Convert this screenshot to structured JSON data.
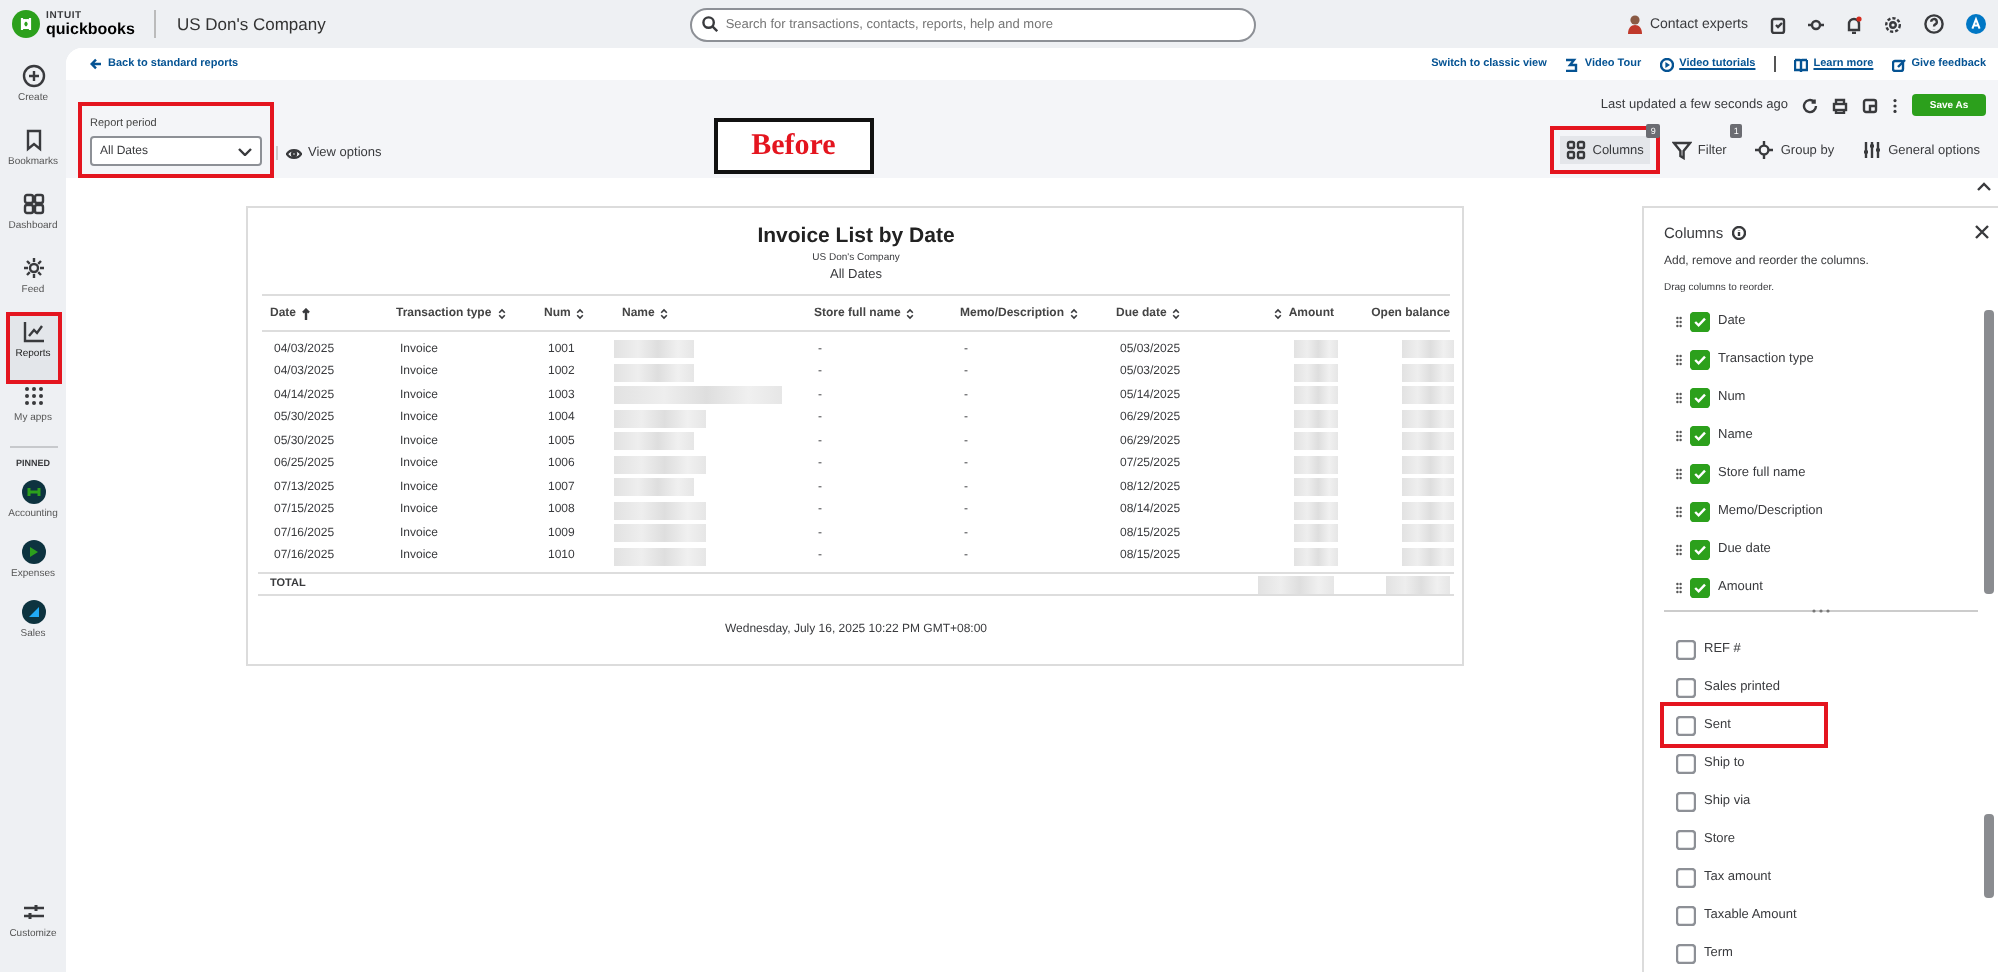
{
  "app": {
    "logo_top": "INTUIT",
    "logo_bottom": "quickbooks",
    "company": "US Don's Company",
    "search_placeholder": "Search for transactions, contacts, reports, help and more",
    "contact": "Contact experts"
  },
  "sidebar": {
    "items": [
      {
        "label": "Create",
        "selected": false,
        "highlighted": false
      },
      {
        "label": "Bookmarks",
        "selected": false,
        "highlighted": false
      },
      {
        "label": "Dashboard",
        "selected": false,
        "highlighted": false
      },
      {
        "label": "Feed",
        "selected": false,
        "highlighted": false
      },
      {
        "label": "Reports",
        "selected": true,
        "highlighted": true
      },
      {
        "label": "My apps",
        "selected": false,
        "highlighted": false
      }
    ],
    "pinned_heading": "PINNED",
    "pinned": [
      {
        "label": "Accounting"
      },
      {
        "label": "Expenses"
      },
      {
        "label": "Sales"
      }
    ],
    "customize": "Customize"
  },
  "subbar": {
    "back": "Back to standard reports",
    "links": [
      {
        "label": "Switch to classic view",
        "underlined": false
      },
      {
        "label": "Video Tour",
        "underlined": false
      },
      {
        "label": "Video tutorials",
        "underlined": true
      },
      {
        "label": "Learn more",
        "underlined": true
      },
      {
        "label": "Give feedback",
        "underlined": false
      }
    ]
  },
  "toolbar": {
    "report_period": {
      "label": "Report period",
      "value": "All Dates",
      "highlighted": true
    },
    "view_options": "View options",
    "last_updated": "Last updated a few seconds ago",
    "save": "Save As",
    "actions": [
      {
        "label": "Columns",
        "badge": "9",
        "highlighted": true
      },
      {
        "label": "Filter",
        "badge": "1",
        "highlighted": false
      },
      {
        "label": "Group by",
        "highlighted": false
      },
      {
        "label": "General options",
        "highlighted": false
      }
    ]
  },
  "annotation": {
    "text": "Before"
  },
  "report": {
    "title": "Invoice List by Date",
    "company": "US Don's Company",
    "period": "All Dates",
    "columns": [
      {
        "label": "Date",
        "sorted_ascending": true,
        "right_aligned": false
      },
      {
        "label": "Transaction type",
        "sorted_ascending": false,
        "sortable": true,
        "right_aligned": false
      },
      {
        "label": "Num",
        "sorted_ascending": false,
        "sortable": true,
        "right_aligned": false
      },
      {
        "label": "Name",
        "sorted_ascending": false,
        "sortable": true,
        "right_aligned": false
      },
      {
        "label": "Store full name",
        "sorted_ascending": false,
        "sortable": true,
        "right_aligned": false
      },
      {
        "label": "Memo/Description",
        "sorted_ascending": false,
        "sortable": true,
        "right_aligned": false
      },
      {
        "label": "Due date",
        "sorted_ascending": false,
        "sortable": true,
        "right_aligned": false
      },
      {
        "label": "Amount",
        "sorted_ascending": false,
        "sortable": true,
        "right_aligned": true
      },
      {
        "label": "Open balance",
        "sorted_ascending": false,
        "sortable": false,
        "right_aligned": true
      }
    ],
    "rows": [
      [
        "04/03/2025",
        "Invoice",
        "1001",
        null,
        "-",
        "-",
        "05/03/2025",
        null,
        null
      ],
      [
        "04/03/2025",
        "Invoice",
        "1002",
        null,
        "-",
        "-",
        "05/03/2025",
        null,
        null
      ],
      [
        "04/14/2025",
        "Invoice",
        "1003",
        null,
        "-",
        "-",
        "05/14/2025",
        null,
        null
      ],
      [
        "05/30/2025",
        "Invoice",
        "1004",
        null,
        "-",
        "-",
        "06/29/2025",
        null,
        null
      ],
      [
        "05/30/2025",
        "Invoice",
        "1005",
        null,
        "-",
        "-",
        "06/29/2025",
        null,
        null
      ],
      [
        "06/25/2025",
        "Invoice",
        "1006",
        null,
        "-",
        "-",
        "07/25/2025",
        null,
        null
      ],
      [
        "07/13/2025",
        "Invoice",
        "1007",
        null,
        "-",
        "-",
        "08/12/2025",
        null,
        null
      ],
      [
        "07/15/2025",
        "Invoice",
        "1008",
        null,
        "-",
        "-",
        "08/14/2025",
        null,
        null
      ],
      [
        "07/16/2025",
        "Invoice",
        "1009",
        null,
        "-",
        "-",
        "08/15/2025",
        null,
        null
      ],
      [
        "07/16/2025",
        "Invoice",
        "1010",
        null,
        "-",
        "-",
        "08/15/2025",
        null,
        null
      ]
    ],
    "total": {
      "label": "TOTAL"
    },
    "footer": "Wednesday, July 16, 2025 10:22 PM GMT+08:00"
  },
  "columns_panel": {
    "title": "Columns",
    "hint": "Add, remove and reorder the columns.",
    "drag_hint": "Drag columns to reorder.",
    "items": [
      {
        "label": "Date",
        "checked": true,
        "highlighted": false
      },
      {
        "label": "Transaction type",
        "checked": true,
        "highlighted": false
      },
      {
        "label": "Num",
        "checked": true,
        "highlighted": false
      },
      {
        "label": "Name",
        "checked": true,
        "highlighted": false
      },
      {
        "label": "Store full name",
        "checked": true,
        "highlighted": false
      },
      {
        "label": "Memo/Description",
        "checked": true,
        "highlighted": false
      },
      {
        "label": "Due date",
        "checked": true,
        "highlighted": false
      },
      {
        "label": "Amount",
        "checked": true,
        "highlighted": false
      },
      {
        "label": "REF #",
        "checked": false,
        "highlighted": false
      },
      {
        "label": "Sales printed",
        "checked": false,
        "highlighted": false
      },
      {
        "label": "Sent",
        "checked": false,
        "highlighted": true
      },
      {
        "label": "Ship to",
        "checked": false,
        "highlighted": false
      },
      {
        "label": "Ship via",
        "checked": false,
        "highlighted": false
      },
      {
        "label": "Store",
        "checked": false,
        "highlighted": false
      },
      {
        "label": "Tax amount",
        "checked": false,
        "highlighted": false
      },
      {
        "label": "Taxable Amount",
        "checked": false,
        "highlighted": false
      },
      {
        "label": "Term",
        "checked": false,
        "highlighted": false
      }
    ]
  }
}
